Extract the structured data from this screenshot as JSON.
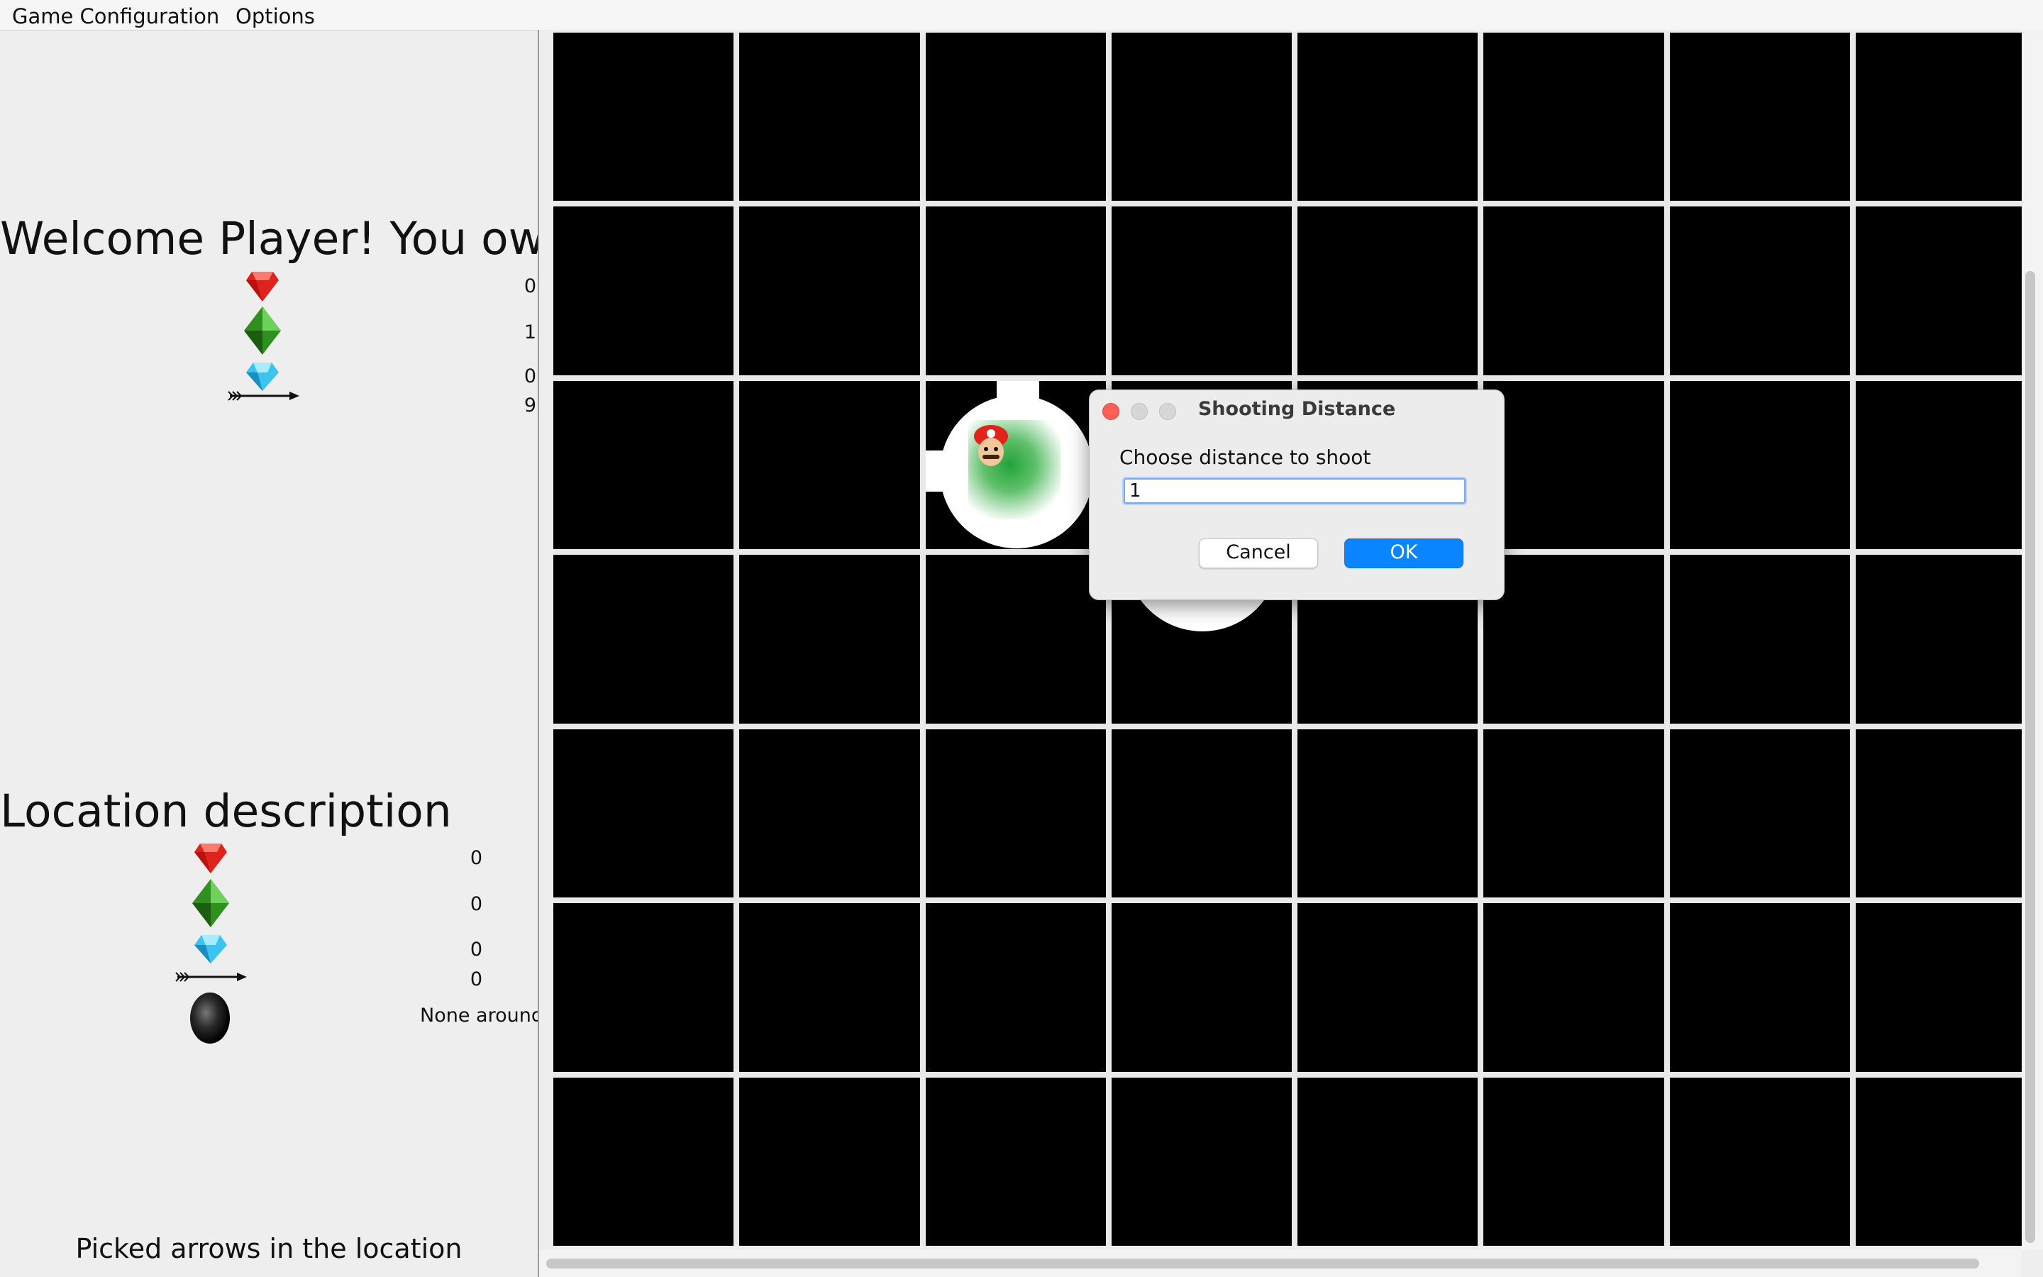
{
  "menu": {
    "items": [
      "Game Configuration",
      "Options"
    ]
  },
  "player": {
    "title": "Welcome Player! You own",
    "items": [
      {
        "icon": "ruby-icon",
        "value": "0"
      },
      {
        "icon": "emerald-icon",
        "value": "1"
      },
      {
        "icon": "diamond-icon",
        "value": "0"
      },
      {
        "icon": "arrow-icon",
        "value": "9"
      }
    ]
  },
  "location": {
    "title": "Location description",
    "items": [
      {
        "icon": "ruby-icon",
        "value": "0"
      },
      {
        "icon": "emerald-icon",
        "value": "0"
      },
      {
        "icon": "diamond-icon",
        "value": "0"
      },
      {
        "icon": "arrow-icon",
        "value": "0"
      },
      {
        "icon": "pit-icon",
        "value": "None around"
      }
    ]
  },
  "footer": {
    "message": "Picked arrows in the location"
  },
  "board": {
    "rows": 7,
    "cols": 8
  },
  "dialog": {
    "title": "Shooting Distance",
    "label": "Choose distance to shoot",
    "input_value": "1",
    "cancel_label": "Cancel",
    "ok_label": "OK",
    "ok_color": "#0a84ff"
  },
  "colors": {
    "ruby": "#e0221c",
    "emerald": "#2f8f1f",
    "diamond": "#3cc3f0",
    "traffic_close": "#ff5f57",
    "traffic_inactive": "#d6d6d6"
  }
}
